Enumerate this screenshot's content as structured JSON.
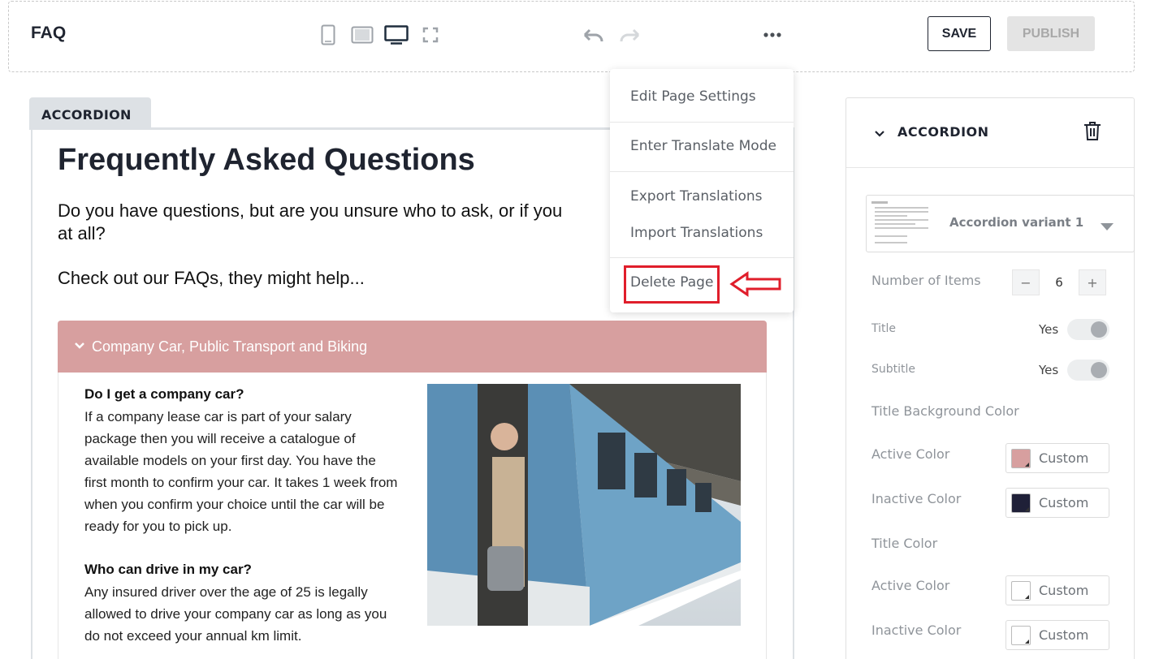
{
  "header": {
    "title": "FAQ",
    "save_label": "SAVE",
    "publish_label": "PUBLISH",
    "device_icons": [
      "mobile-icon",
      "tablet-icon",
      "desktop-icon",
      "fullscreen-icon"
    ],
    "history_icons": [
      "undo-icon",
      "redo-icon"
    ]
  },
  "menu": {
    "items": [
      "Edit Page Settings",
      "Enter Translate Mode",
      "Export Translations",
      "Import Translations",
      "Delete Page"
    ],
    "highlight_color": "#e01e2b"
  },
  "canvas": {
    "block_tab": "ACCORDION",
    "title": "Frequently Asked Questions",
    "intro": "Do you have questions, but are you unsure who to ask, or if you at all?",
    "intro_line1": "Do you have questions, but are you unsure who to ask, or if you",
    "intro_line2": "at all?",
    "intro2": "Check out our FAQs, they might help...",
    "accordion": {
      "header": "Company Car, Public Transport and Biking",
      "header_color": "#d79f9f",
      "q1": "Do I get a company car?",
      "a1": "If a company lease car is part of your salary package then you will receive a catalogue of available models on your first day. You have the first month to confirm your car. It takes 1 week from when you confirm your choice until the car will be ready for you to pick up.",
      "q2": "Who can drive in my car?",
      "a2": "Any insured driver over the age of 25 is legally allowed to drive your company car as long as you do not exceed your annual km limit."
    }
  },
  "panel": {
    "title": "ACCORDION",
    "variant": "Accordion variant 1",
    "number_of_items_label": "Number of Items",
    "number_of_items": "6",
    "minus": "−",
    "plus": "+",
    "title_label": "Title",
    "title_value": "Yes",
    "subtitle_label": "Subtitle",
    "subtitle_value": "Yes",
    "title_bg_color_label": "Title Background Color",
    "active_color_label": "Active Color",
    "inactive_color_label": "Inactive Color",
    "title_color_label": "Title Color",
    "custom": "Custom",
    "colors": {
      "bg_active": "#d79f9f",
      "bg_inactive": "#1f2038",
      "title_active": "#ffffff",
      "title_inactive": "#ffffff"
    }
  }
}
